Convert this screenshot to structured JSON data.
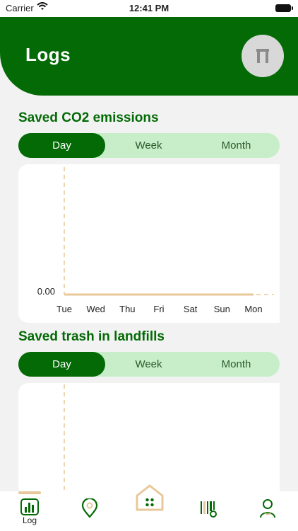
{
  "status_bar": {
    "carrier": "Carrier",
    "time": "12:41 PM"
  },
  "header": {
    "title": "Logs",
    "avatar_glyph": "Π"
  },
  "sections": [
    {
      "title": "Saved CO2 emissions",
      "segments": [
        "Day",
        "Week",
        "Month"
      ],
      "selected_segment": "Day"
    },
    {
      "title": "Saved trash in landfills",
      "segments": [
        "Day",
        "Week",
        "Month"
      ],
      "selected_segment": "Day"
    }
  ],
  "chart_data": [
    {
      "type": "line",
      "title": "",
      "x": [
        "Tue",
        "Wed",
        "Thu",
        "Fri",
        "Sat",
        "Sun",
        "Mon"
      ],
      "series": [
        {
          "values": [
            0,
            0,
            0,
            0,
            0,
            0,
            0
          ]
        }
      ],
      "y_tick_labels": [
        "0.00"
      ],
      "grid": false,
      "colors": {
        "line": "#e8c89a",
        "axis": "#e8c89a"
      }
    },
    {
      "type": "line",
      "title": "",
      "x": [],
      "series": [],
      "grid": false,
      "colors": {
        "axis": "#e8c89a"
      }
    }
  ],
  "tabbar": {
    "items": [
      {
        "label": "Log",
        "icon": "bar-chart-icon"
      },
      {
        "label": "",
        "icon": "location-pin-icon"
      },
      {
        "label": "",
        "icon": "home-icon"
      },
      {
        "label": "",
        "icon": "barcode-scan-icon"
      },
      {
        "label": "",
        "icon": "profile-icon"
      }
    ]
  },
  "colors": {
    "primary": "#036a06",
    "segment_bg": "#c8eec9",
    "accent": "#e8c89a",
    "background": "#f2f2f2"
  }
}
